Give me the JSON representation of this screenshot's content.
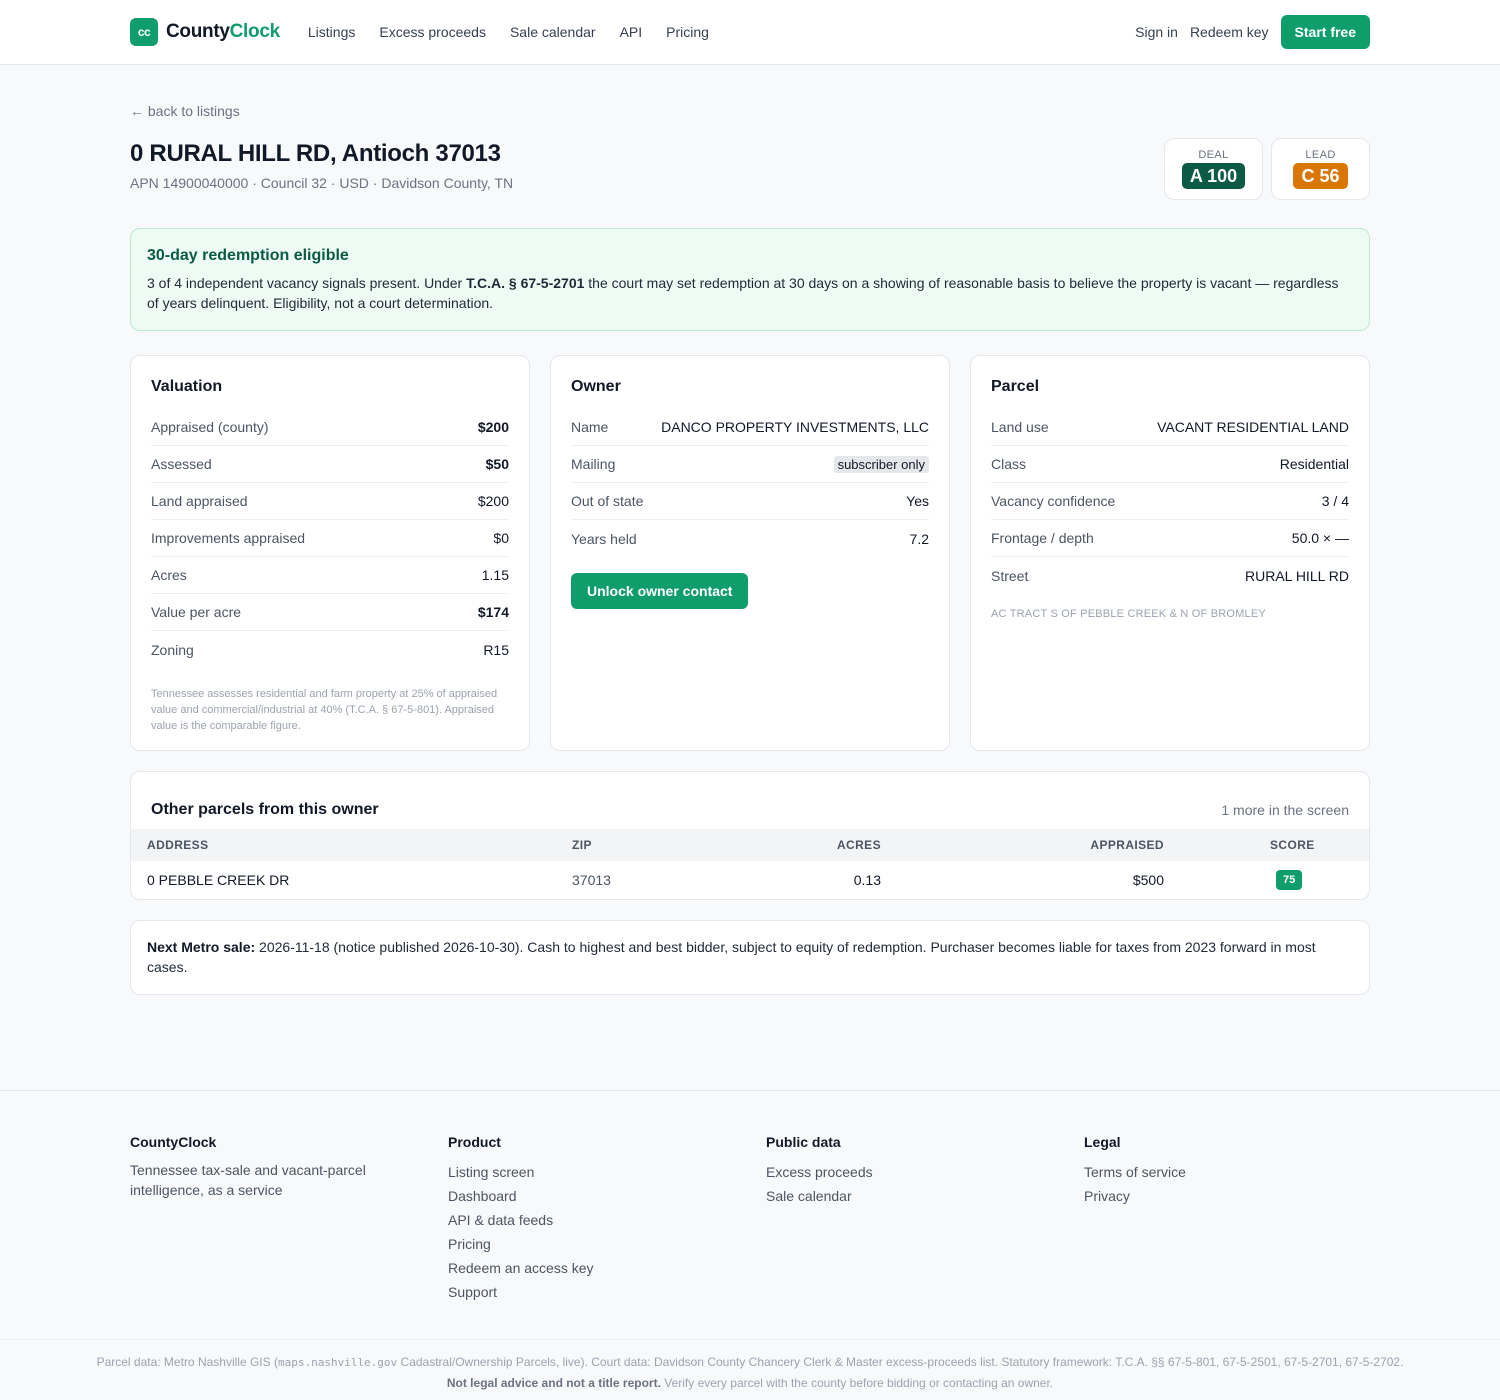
{
  "header": {
    "brand_mark": "cc",
    "brand_part1": "County",
    "brand_part2": "Clock",
    "nav": [
      "Listings",
      "Excess proceeds",
      "Sale calendar",
      "API",
      "Pricing"
    ],
    "sign_in": "Sign in",
    "redeem_key": "Redeem key",
    "start_free": "Start free"
  },
  "page": {
    "back_link": "← back to listings",
    "title": "0 RURAL HILL RD, Antioch 37013",
    "subtitle": "APN 14900040000 · Council 32 · USD · Davidson County, TN",
    "deal": {
      "label": "DEAL",
      "grade": "A 100"
    },
    "lead": {
      "label": "LEAD",
      "grade": "C 56"
    }
  },
  "alert": {
    "title": "30-day redemption eligible",
    "body_pre": "3 of 4 independent vacancy signals present. Under ",
    "body_statute": "T.C.A. § 67-5-2701",
    "body_post": " the court may set redemption at 30 days on a showing of reasonable basis to believe the property is vacant — regardless of years delinquent. Eligibility, not a court determination."
  },
  "valuation": {
    "title": "Valuation",
    "rows": [
      {
        "k": "Appraised (county)",
        "v": "$200"
      },
      {
        "k": "Assessed",
        "v": "$50"
      },
      {
        "k": "Land appraised",
        "v": "$200"
      },
      {
        "k": "Improvements appraised",
        "v": "$0"
      },
      {
        "k": "Acres",
        "v": "1.15"
      },
      {
        "k": "Value per acre",
        "v": "$174"
      },
      {
        "k": "Zoning",
        "v": "R15"
      }
    ],
    "note": "Tennessee assesses residential and farm property at 25% of appraised value and commercial/industrial at 40% (T.C.A. § 67-5-801). Appraised value is the comparable figure."
  },
  "owner": {
    "title": "Owner",
    "rows": [
      {
        "k": "Name",
        "v": "DANCO PROPERTY INVESTMENTS, LLC"
      },
      {
        "k": "Mailing",
        "v": "subscriber only"
      },
      {
        "k": "Out of state",
        "v": "Yes"
      },
      {
        "k": "Years held",
        "v": "7.2"
      }
    ],
    "unlock": "Unlock owner contact"
  },
  "parcel": {
    "title": "Parcel",
    "rows": [
      {
        "k": "Land use",
        "v": "VACANT RESIDENTIAL LAND"
      },
      {
        "k": "Class",
        "v": "Residential"
      },
      {
        "k": "Vacancy confidence",
        "v": "3 / 4"
      },
      {
        "k": "Frontage / depth",
        "v": "50.0 × —"
      },
      {
        "k": "Street",
        "v": "RURAL HILL RD"
      }
    ],
    "legal_desc": "AC TRACT S OF PEBBLE CREEK & N OF BROMLEY"
  },
  "other_parcels": {
    "title": "Other parcels from this owner",
    "more": "1 more in the screen",
    "columns": [
      "ADDRESS",
      "ZIP",
      "ACRES",
      "APPRAISED",
      "SCORE"
    ],
    "rows": [
      {
        "address": "0 PEBBLE CREEK DR",
        "zip": "37013",
        "acres": "0.13",
        "appraised": "$500",
        "score": "75"
      }
    ]
  },
  "next_sale": {
    "label": "Next Metro sale:",
    "text": " 2026-11-18 (notice published 2026-10-30). Cash to highest and best bidder, subject to equity of redemption. Purchaser becomes liable for taxes from 2023 forward in most cases."
  },
  "footer": {
    "brand": "CountyClock",
    "desc": "Tennessee tax-sale and vacant-parcel intelligence, as a service",
    "product_title": "Product",
    "product_links": [
      "Listing screen",
      "Dashboard",
      "API & data feeds",
      "Pricing",
      "Redeem an access key",
      "Support"
    ],
    "public_title": "Public data",
    "public_links": [
      "Excess proceeds",
      "Sale calendar"
    ],
    "legal_title": "Legal",
    "legal_links": [
      "Terms of service",
      "Privacy"
    ],
    "source_pre": "Parcel data: Metro Nashville GIS (",
    "source_code": "maps.nashville.gov",
    "source_post": " Cadastral/Ownership Parcels, live). Court data: Davidson County Chancery Clerk & Master excess-proceeds list. Statutory framework: T.C.A. §§ 67-5-801, 67-5-2501, 67-5-2701, 67-5-2702.",
    "disclaimer_bold": "Not legal advice and not a title report.",
    "disclaimer_rest": " Verify every parcel with the county before bidding or contacting an owner."
  }
}
